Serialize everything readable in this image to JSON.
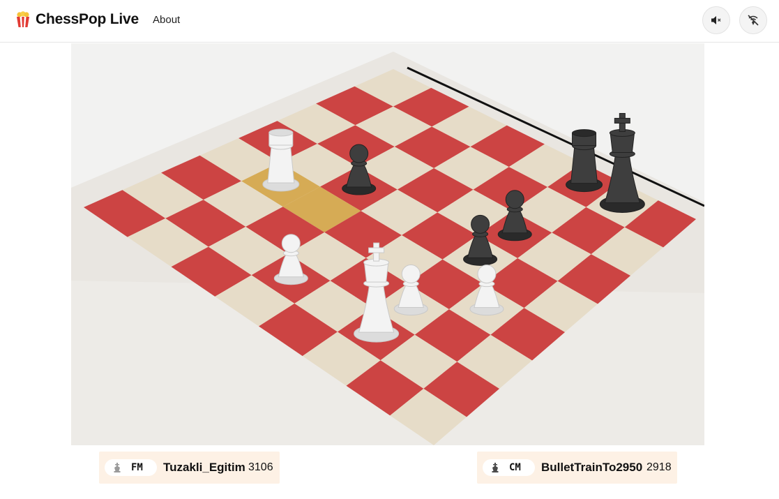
{
  "header": {
    "app_name": "ChessPop Live",
    "nav_about": "About",
    "logo_icon": "popcorn-icon",
    "mute_icon": "speaker-muted-icon",
    "cast_icon": "broadcast-off-icon"
  },
  "board": {
    "light_square": "#e6dcc8",
    "dark_square": "#cc4443",
    "highlight": "#d6ab55",
    "pieces": [
      {
        "color": "black",
        "type": "rook",
        "square": "f8"
      },
      {
        "color": "black",
        "type": "king",
        "square": "g8"
      },
      {
        "color": "black",
        "type": "pawn",
        "square": "f6"
      },
      {
        "color": "black",
        "type": "pawn",
        "square": "f5"
      },
      {
        "color": "black",
        "type": "pawn",
        "square": "c5"
      },
      {
        "color": "white",
        "type": "rook",
        "square": "b4"
      },
      {
        "color": "white",
        "type": "pawn",
        "square": "g4"
      },
      {
        "color": "white",
        "type": "pawn",
        "square": "f3"
      },
      {
        "color": "white",
        "type": "pawn",
        "square": "d2"
      },
      {
        "color": "white",
        "type": "king",
        "square": "f2"
      }
    ]
  },
  "players": {
    "white": {
      "title": "FM",
      "name": "Tuzakli_Egitim",
      "rating": "3106",
      "icon": "white-king-icon"
    },
    "black": {
      "title": "CM",
      "name": "BulletTrainTo2950",
      "rating": "2918",
      "icon": "black-king-icon"
    }
  }
}
